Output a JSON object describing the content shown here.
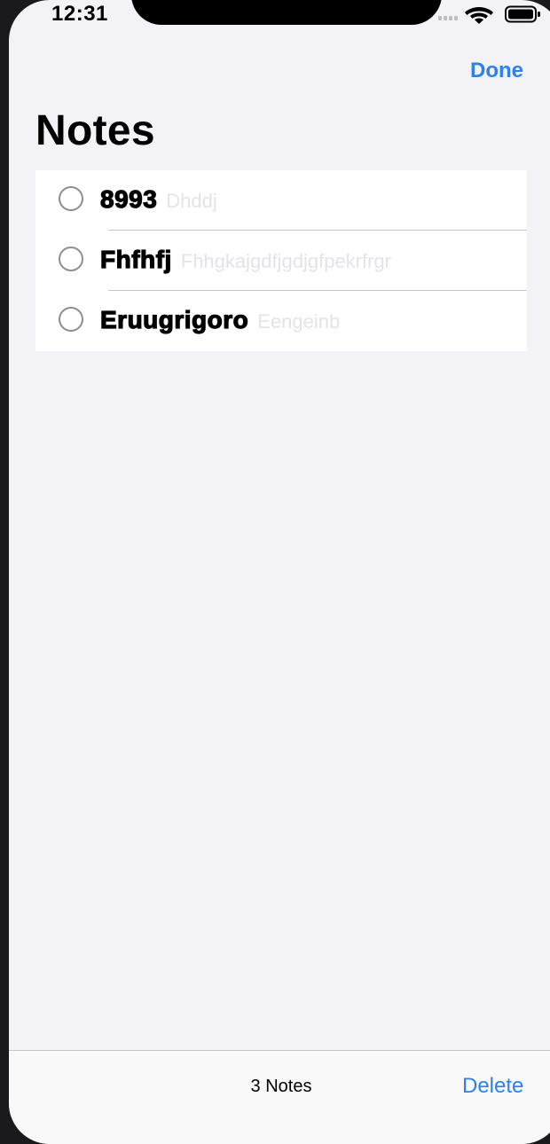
{
  "status_bar": {
    "time": "12:31"
  },
  "nav": {
    "done_label": "Done"
  },
  "title": "Notes",
  "notes": [
    {
      "title": "8993",
      "preview": "Dhddj"
    },
    {
      "title": "Fhfhfj",
      "preview": "Fhhgkajgdfjgdjgfpekrfrgr"
    },
    {
      "title": "Eruugrigoro",
      "preview": "Eengeinb"
    }
  ],
  "toolbar": {
    "count_label": "3 Notes",
    "delete_label": "Delete"
  },
  "colors": {
    "accent": "#2f80ed",
    "background": "#f2f2f7",
    "preview_text": "#e3e3e8"
  },
  "icons": [
    "cellular-signal-icon",
    "wifi-icon",
    "battery-icon",
    "radio-unselected-icon"
  ]
}
